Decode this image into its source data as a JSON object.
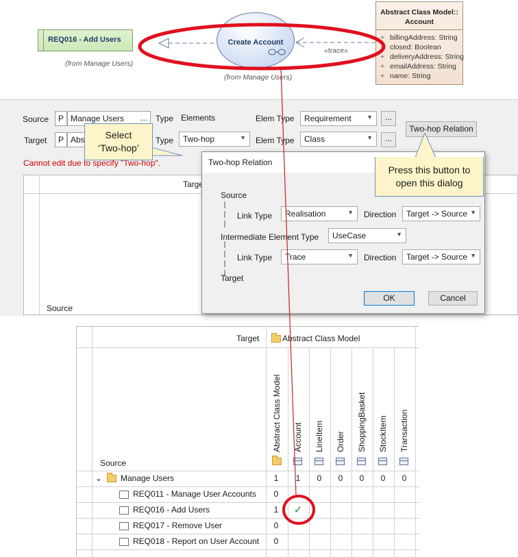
{
  "diagram": {
    "requirement": "REQ016 - Add Users",
    "requirement_from": "(from Manage Users)",
    "usecase": "Create Account",
    "usecase_from": "(from Manage Users)",
    "trace_label": "«trace»",
    "class_title_line1": "Abstract Class Model::",
    "class_title_line2": "Account",
    "class_attrs": [
      {
        "vis": "+",
        "text": "billingAddress: String"
      },
      {
        "vis": "+",
        "text": "closed: Boolean"
      },
      {
        "vis": "+",
        "text": "deliveryAddress: String"
      },
      {
        "vis": "+",
        "text": "emailAddress: String"
      },
      {
        "vis": "+",
        "text": "name: String"
      }
    ]
  },
  "criteria": {
    "source_label": "Source",
    "target_label": "Target",
    "source_p": "P",
    "target_p": "P",
    "source_package": "Manage Users",
    "target_package": "Abs",
    "source_dots": "...",
    "type_label": "Type",
    "type_value": "Elements",
    "type2_label": "Type",
    "type2_value": "Two-hop",
    "elem_type_label": "Elem Type",
    "source_elem_type": "Requirement",
    "target_elem_type": "Class",
    "dots": "...",
    "two_hop_button": "Two-hop Relation",
    "error": "Cannot edit due to specify \"Two-hop\".",
    "grid_target_header": "Target",
    "grid_source_header": "Source"
  },
  "callouts": {
    "select_line1": "Select",
    "select_line2": "‘Two-hop’",
    "press_line1": "Press this button to",
    "press_line2": "open this dialog"
  },
  "dialog": {
    "title": "Two-hop Relation",
    "source": "Source",
    "link_type_label": "Link Type",
    "link_type_1": "Realisation",
    "direction_label": "Direction",
    "direction_1": "Target -> Source",
    "intermediate_label": "Intermediate Element Type",
    "intermediate_value": "UseCase",
    "link_type_2": "Trace",
    "direction_2": "Target -> Source",
    "target": "Target",
    "ok": "OK",
    "cancel": "Cancel"
  },
  "matrix": {
    "target_label": "Target",
    "target_package": "Abstract Class Model",
    "source_label": "Source",
    "columns": [
      "Abstract Class Model",
      "Account",
      "LineItem",
      "Order",
      "ShoppingBasket",
      "StockItem",
      "Transaction"
    ],
    "group": {
      "expander": "⌄",
      "name": "Manage Users",
      "counts": [
        "1",
        "1",
        "0",
        "0",
        "0",
        "0",
        "0"
      ]
    },
    "rows": [
      {
        "name": "REQ011 - Manage User Accounts",
        "count": "0",
        "mark": ""
      },
      {
        "name": "REQ016 - Add Users",
        "count": "1",
        "mark": "✓"
      },
      {
        "name": "REQ017 - Remove User",
        "count": "0",
        "mark": ""
      },
      {
        "name": "REQ018 - Report on User Account",
        "count": "0",
        "mark": ""
      }
    ]
  },
  "colors": {
    "highlight_ring": "#e0101e",
    "arrow_line": "#c81e24",
    "tooltip_bg": "#fdf5c9"
  }
}
